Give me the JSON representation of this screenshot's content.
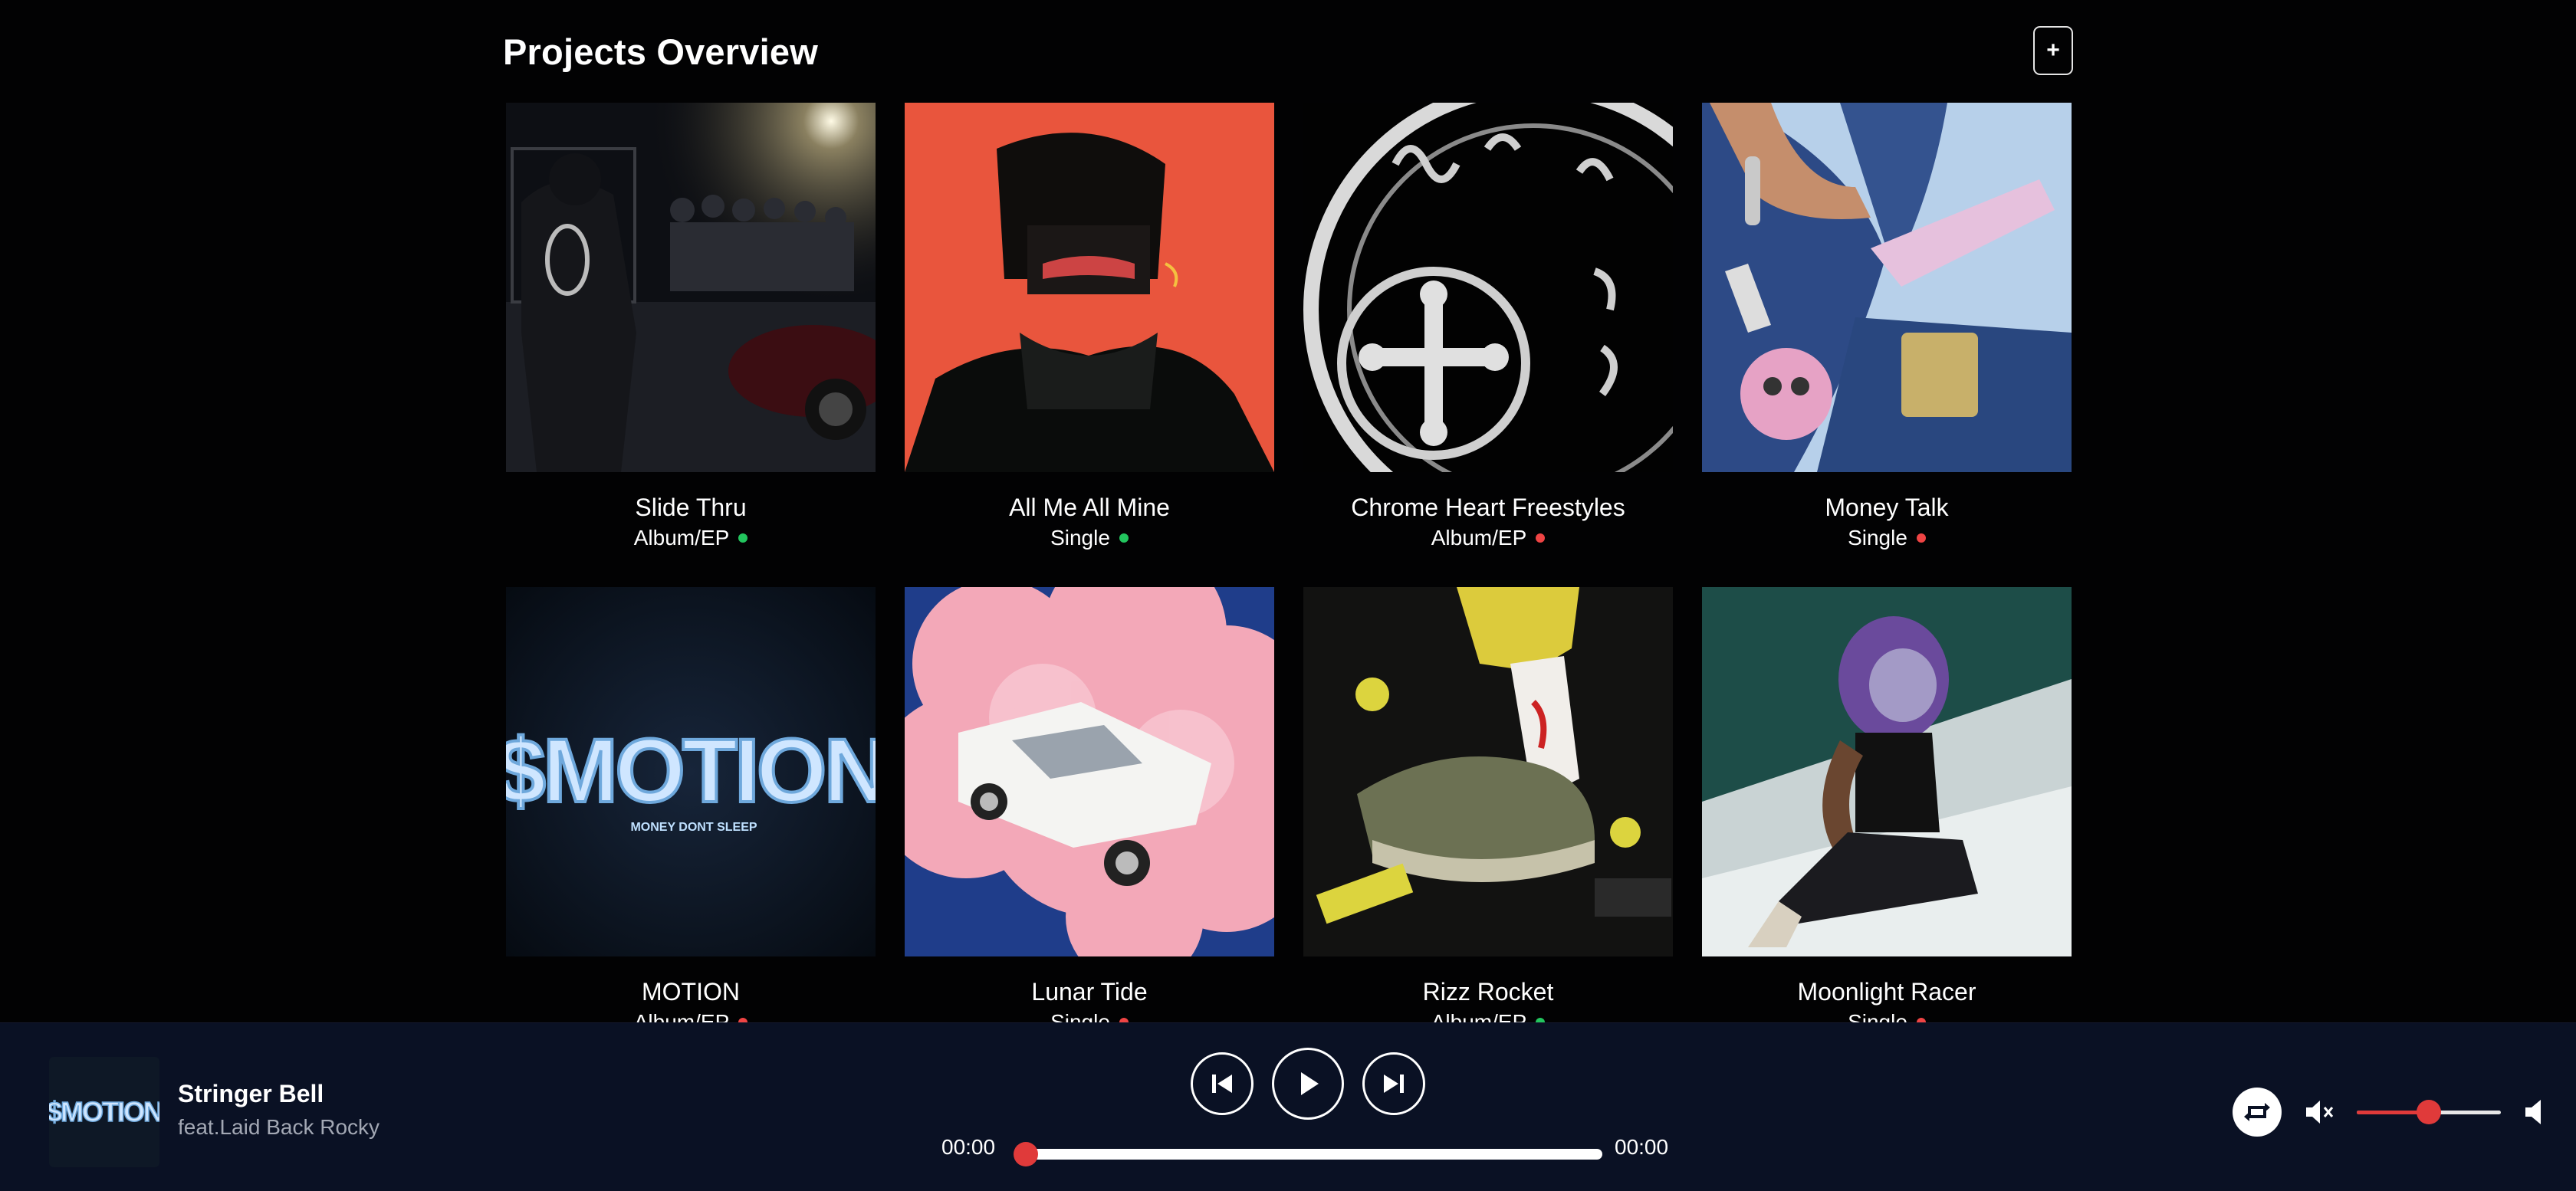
{
  "header": {
    "title": "Projects Overview",
    "add_label": "+"
  },
  "colors": {
    "active": "#22c55e",
    "inactive": "#ef4444",
    "accent": "#e03a3a",
    "player_bg": "#0a1124"
  },
  "projects": [
    {
      "title": "Slide Thru",
      "type": "Album/EP",
      "status": "active",
      "status_color": "#22c55e"
    },
    {
      "title": "All Me All Mine",
      "type": "Single",
      "status": "active",
      "status_color": "#22c55e"
    },
    {
      "title": "Chrome Heart Freestyles",
      "type": "Album/EP",
      "status": "inactive",
      "status_color": "#ef4444"
    },
    {
      "title": "Money Talk",
      "type": "Single",
      "status": "inactive",
      "status_color": "#ef4444"
    },
    {
      "title": "MOTION",
      "type": "Album/EP",
      "status": "inactive",
      "status_color": "#ef4444"
    },
    {
      "title": "Lunar Tide",
      "type": "Single",
      "status": "inactive",
      "status_color": "#ef4444"
    },
    {
      "title": "Rizz Rocket",
      "type": "Album/EP",
      "status": "active",
      "status_color": "#22c55e"
    },
    {
      "title": "Moonlight Racer",
      "type": "Single",
      "status": "inactive",
      "status_color": "#ef4444"
    }
  ],
  "cover_art": {
    "motion_logo_text": "$MOTION",
    "motion_tagline": "MONEY DONT SLEEP"
  },
  "player": {
    "track_title": "Stringer Bell",
    "track_artist": "feat.Laid Back Rocky",
    "current_time": "00:00",
    "total_time": "00:00",
    "progress": 0,
    "volume": 0.5,
    "icons": [
      "skip-back-icon",
      "play-icon",
      "skip-forward-icon",
      "repeat-icon",
      "mute-icon",
      "volume-icon"
    ]
  }
}
